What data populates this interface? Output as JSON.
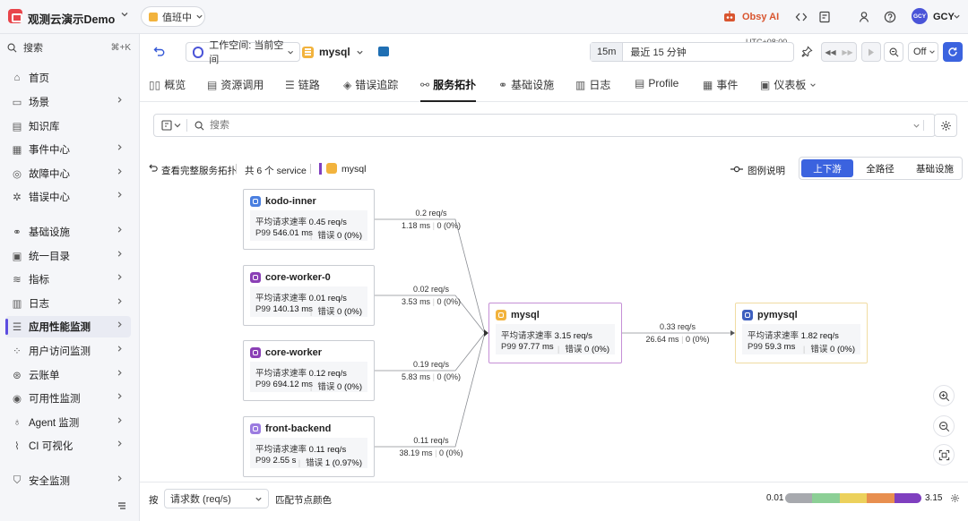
{
  "topbar": {
    "workspace": "观测云演示Demo",
    "duty": "值班中",
    "obsy": "Obsy AI",
    "user": "GCY",
    "avatar_initials": "GCY"
  },
  "sidebar": {
    "search_label": "搜索",
    "search_shortcut": "⌘+K",
    "items": [
      {
        "label": "首页",
        "icon": "home-icon",
        "chevron": false
      },
      {
        "label": "场景",
        "icon": "dashboard-icon",
        "chevron": true
      },
      {
        "label": "知识库",
        "icon": "book-icon",
        "chevron": false
      },
      {
        "label": "事件中心",
        "icon": "event-icon",
        "chevron": true
      },
      {
        "label": "故障中心",
        "icon": "incident-icon",
        "chevron": true
      },
      {
        "label": "错误中心",
        "icon": "bug-icon",
        "chevron": true
      },
      {
        "label": "基础设施",
        "icon": "infra-icon",
        "chevron": true
      },
      {
        "label": "统一目录",
        "icon": "catalog-icon",
        "chevron": true
      },
      {
        "label": "指标",
        "icon": "metrics-icon",
        "chevron": true
      },
      {
        "label": "日志",
        "icon": "log-icon",
        "chevron": true
      },
      {
        "label": "应用性能监测",
        "icon": "apm-icon",
        "chevron": true,
        "active": true
      },
      {
        "label": "用户访问监测",
        "icon": "rum-icon",
        "chevron": true
      },
      {
        "label": "云账单",
        "icon": "cloud-icon",
        "chevron": true
      },
      {
        "label": "可用性监测",
        "icon": "uptime-icon",
        "chevron": true
      },
      {
        "label": "Agent 监测",
        "icon": "agent-icon",
        "chevron": true
      },
      {
        "label": "CI 可视化",
        "icon": "ci-icon",
        "chevron": true
      },
      {
        "label": "安全监测",
        "icon": "security-icon",
        "chevron": true
      }
    ]
  },
  "toolbar": {
    "workspace_selector": "工作空间: 当前空间",
    "service": "mysql",
    "timezone": "UTC+08:00",
    "time_short": "15m",
    "time_range": "最近 15 分钟",
    "refresh": "Off"
  },
  "tabs": [
    {
      "label": "概览",
      "icon": "overview-icon"
    },
    {
      "label": "资源调用",
      "icon": "resource-icon"
    },
    {
      "label": "链路",
      "icon": "trace-icon"
    },
    {
      "label": "错误追踪",
      "icon": "error-icon"
    },
    {
      "label": "服务拓扑",
      "icon": "topology-icon",
      "active": true
    },
    {
      "label": "基础设施",
      "icon": "infra-icon"
    },
    {
      "label": "日志",
      "icon": "log-icon"
    },
    {
      "label": "Profile",
      "icon": "profile-icon"
    },
    {
      "label": "事件",
      "icon": "event-icon"
    },
    {
      "label": "仪表板",
      "icon": "dashboard-icon"
    }
  ],
  "filter": {
    "placeholder": "搜索"
  },
  "topo_header": {
    "back_link": "查看完整服务拓扑",
    "count": "共 6 个 service",
    "service": "mysql",
    "legend": "图例说明",
    "modes": [
      "上下游",
      "全路径",
      "基础设施"
    ],
    "active_mode": 0
  },
  "nodes": [
    {
      "name": "kodo-inner",
      "rate_label": "平均请求速率",
      "rate": "0.45 req/s",
      "p99_label": "P99",
      "p99": "546.01 ms",
      "err_label": "错误",
      "err": "0 (0%)",
      "color": "#4a7fe0"
    },
    {
      "name": "core-worker-0",
      "rate_label": "平均请求速率",
      "rate": "0.01 req/s",
      "p99_label": "P99",
      "p99": "140.13 ms",
      "err_label": "错误",
      "err": "0 (0%)",
      "color": "#8a3fb5"
    },
    {
      "name": "core-worker",
      "rate_label": "平均请求速率",
      "rate": "0.12 req/s",
      "p99_label": "P99",
      "p99": "694.12 ms",
      "err_label": "错误",
      "err": "0 (0%)",
      "color": "#8a3fb5"
    },
    {
      "name": "front-backend",
      "rate_label": "平均请求速率",
      "rate": "0.11 req/s",
      "p99_label": "P99",
      "p99": "2.55 s",
      "err_label": "错误",
      "err": "1 (0.97%)",
      "color": "#9b7be0"
    },
    {
      "name": "mysql",
      "rate_label": "平均请求速率",
      "rate": "3.15 req/s",
      "p99_label": "P99",
      "p99": "97.77 ms",
      "err_label": "错误",
      "err": "0 (0%)",
      "color": "#f2b33d"
    },
    {
      "name": "pymysql",
      "rate_label": "平均请求速率",
      "rate": "1.82 req/s",
      "p99_label": "P99",
      "p99": "59.3 ms",
      "err_label": "错误",
      "err": "0 (0%)",
      "color": "#3d5fbf"
    }
  ],
  "edges": [
    {
      "rate": "0.2 req/s",
      "latency": "1.18 ms",
      "err": "0 (0%)"
    },
    {
      "rate": "0.02 req/s",
      "latency": "3.53 ms",
      "err": "0 (0%)"
    },
    {
      "rate": "0.19 req/s",
      "latency": "5.83 ms",
      "err": "0 (0%)"
    },
    {
      "rate": "0.11 req/s",
      "latency": "38.19 ms",
      "err": "0 (0%)"
    },
    {
      "rate": "0.33 req/s",
      "latency": "26.64 ms",
      "err": "0 (0%)"
    }
  ],
  "bottom": {
    "prefix": "按",
    "metric": "请求数 (req/s)",
    "suffix": "匹配节点颜色",
    "scale_min": "0.01",
    "scale_max": "3.15",
    "scale_colors": [
      "#a7a9ae",
      "#8ccf96",
      "#ecd15c",
      "#e88f4f",
      "#7f3fbf"
    ]
  }
}
